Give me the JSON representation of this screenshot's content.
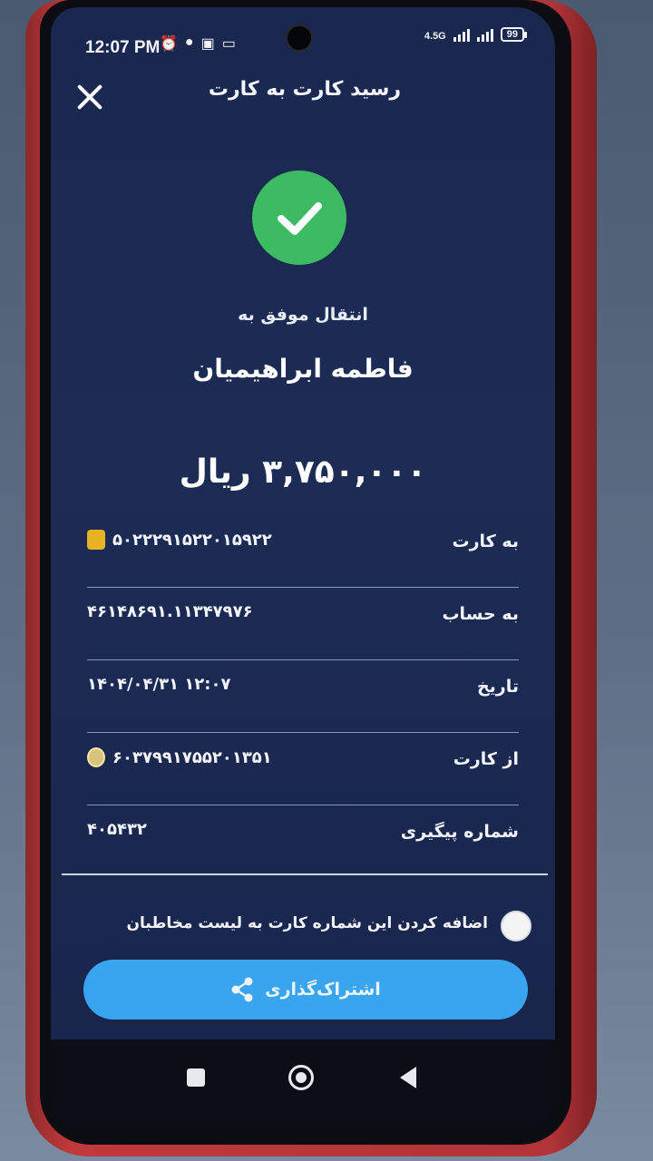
{
  "status_bar": {
    "time": "12:07 PM",
    "network": "4.5G",
    "battery": "99"
  },
  "header": {
    "title": "رسید کارت به کارت"
  },
  "result": {
    "status": "انتقال موفق به",
    "recipient": "فاطمه ابراهیمیان",
    "amount": "۳,۷۵۰,۰۰۰ ریال"
  },
  "details": [
    {
      "label": "به کارت",
      "value": "۵۰۲۲۲۹۱۵۲۲۰۱۵۹۲۲"
    },
    {
      "label": "به حساب",
      "value": "۴۶۱۴۸۶۹۱.۱۱۳۴۷۹۷۶"
    },
    {
      "label": "تاریخ",
      "value": "۱۴۰۴/۰۴/۳۱  ۱۲:۰۷"
    },
    {
      "label": "از کارت",
      "value": "۶۰۳۷۹۹۱۷۵۵۲۰۱۳۵۱"
    },
    {
      "label": "شماره پیگیری",
      "value": "۴۰۵۴۳۲"
    }
  ],
  "add_contact": {
    "label": "اضافه کردن این شماره کارت به لیست مخاطبان",
    "checked": false
  },
  "share": {
    "label": "اشتراک‌گذاری"
  },
  "colors": {
    "success": "#3dbb63",
    "primary_button": "#3aa5ef",
    "background": "#1c2a53"
  }
}
